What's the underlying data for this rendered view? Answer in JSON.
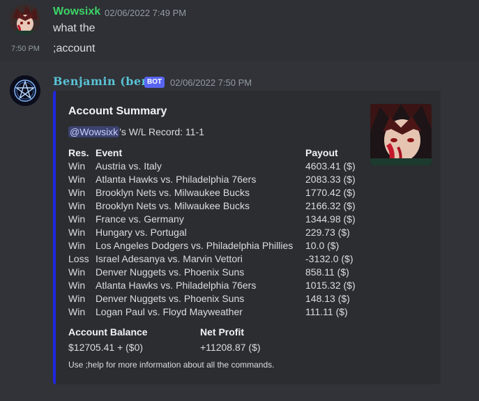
{
  "message1": {
    "username": "Wowsixk",
    "timestamp": "02/06/2022 7:49 PM",
    "text": "what the",
    "avatar_icon": "anime-character-avatar"
  },
  "message2": {
    "side_time": "7:50 PM",
    "text": ";account"
  },
  "bot_message": {
    "username": "Benjamin (ben)",
    "badge": "BOT",
    "timestamp": "02/06/2022 7:50 PM",
    "avatar_icon": "pentagram-avatar"
  },
  "embed": {
    "accent_color": "#2026e0",
    "title": "Account Summary",
    "mention": "@Wowsixk",
    "record_text": "'s W/L Record: 11-1",
    "headers": {
      "result": "Res.",
      "event": "Event",
      "payout": "Payout"
    },
    "rows": [
      {
        "result": "Win",
        "event": "Austria vs. Italy",
        "payout": "4603.41 ($)"
      },
      {
        "result": "Win",
        "event": "Atlanta Hawks vs. Philadelphia 76ers",
        "payout": "2083.33 ($)"
      },
      {
        "result": "Win",
        "event": "Brooklyn Nets vs. Milwaukee Bucks",
        "payout": "1770.42 ($)"
      },
      {
        "result": "Win",
        "event": "Brooklyn Nets vs. Milwaukee Bucks",
        "payout": "2166.32 ($)"
      },
      {
        "result": "Win",
        "event": "France vs. Germany",
        "payout": "1344.98 ($)"
      },
      {
        "result": "Win",
        "event": "Hungary vs. Portugal",
        "payout": "229.73 ($)"
      },
      {
        "result": "Win",
        "event": "Los Angeles Dodgers vs. Philadelphia Phillies",
        "payout": "10.0 ($)"
      },
      {
        "result": "Loss",
        "event": "Israel Adesanya vs. Marvin Vettori",
        "payout": "-3132.0 ($)"
      },
      {
        "result": "Win",
        "event": "Denver Nuggets vs. Phoenix Suns",
        "payout": "858.11 ($)"
      },
      {
        "result": "Win",
        "event": "Atlanta Hawks vs. Philadelphia 76ers",
        "payout": "1015.32 ($)"
      },
      {
        "result": "Win",
        "event": "Denver Nuggets vs. Phoenix Suns",
        "payout": "148.13 ($)"
      },
      {
        "result": "Win",
        "event": "Logan Paul vs. Floyd Mayweather",
        "payout": "111.11 ($)"
      }
    ],
    "balance_label": "Account Balance",
    "balance_value": "$12705.41 + ($0)",
    "profit_label": "Net Profit",
    "profit_value": "+11208.87 ($)",
    "footer": "Use ;help for more information about all the commands.",
    "thumbnail_icon": "anime-character-thumbnail"
  }
}
